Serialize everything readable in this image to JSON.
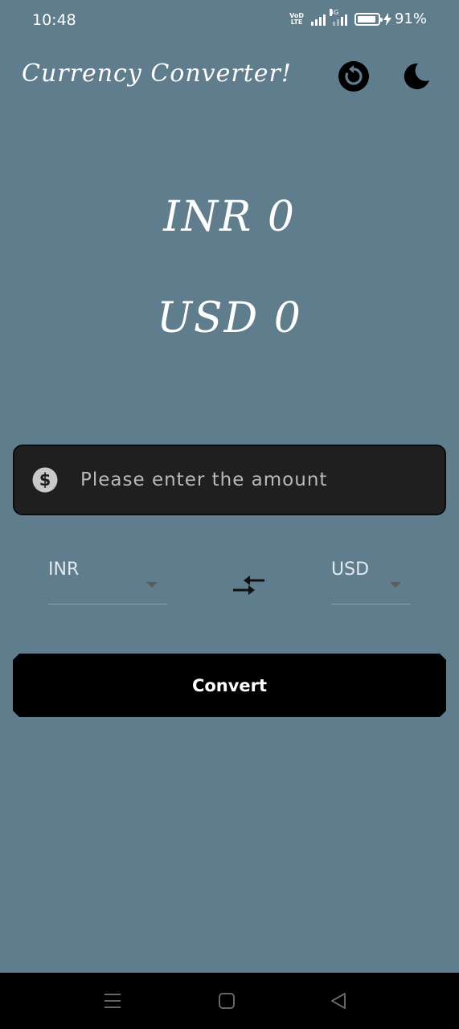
{
  "status_bar": {
    "time": "10:48",
    "volte_line1": "VoD",
    "volte_line2": "LTE",
    "network": "4G",
    "battery_percent": 91,
    "battery_label": "91%",
    "charging": true
  },
  "header": {
    "title": "Currency Converter!",
    "reset_icon": "reset-icon",
    "theme_icon": "moon-icon"
  },
  "result": {
    "from_line": "INR 0",
    "to_line": "USD 0"
  },
  "amount_input": {
    "placeholder": "Please enter the amount",
    "value": "",
    "icon": "dollar-icon"
  },
  "currency": {
    "from": "INR",
    "to": "USD",
    "swap_icon": "swap-arrows-icon"
  },
  "actions": {
    "convert_label": "Convert"
  },
  "nav_bar": {
    "icons": [
      "menu-icon",
      "home-icon",
      "back-icon"
    ]
  },
  "colors": {
    "background": "#5f7d8c",
    "input_background": "#1f1f1f",
    "button_background": "#000000",
    "text": "#ffffff"
  }
}
